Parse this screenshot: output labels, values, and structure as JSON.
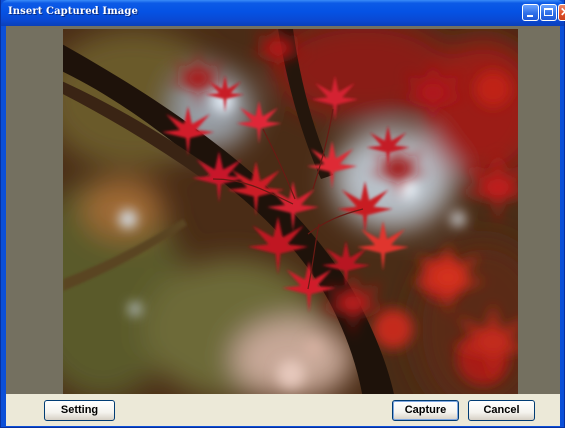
{
  "window": {
    "title": "Insert Captured Image"
  },
  "titlebar_buttons": {
    "minimize_icon": "minimize-icon",
    "maximize_icon": "maximize-icon",
    "close_icon": "close-icon",
    "close_glyph": "✕"
  },
  "preview": {
    "description_icon": "captured-image",
    "accent_colors": [
      "#c8141e",
      "#e23a2a",
      "#3c2412",
      "#7a8a3a"
    ]
  },
  "buttons": {
    "setting_label": "Setting",
    "capture_label": "Capture",
    "cancel_label": "Cancel"
  }
}
